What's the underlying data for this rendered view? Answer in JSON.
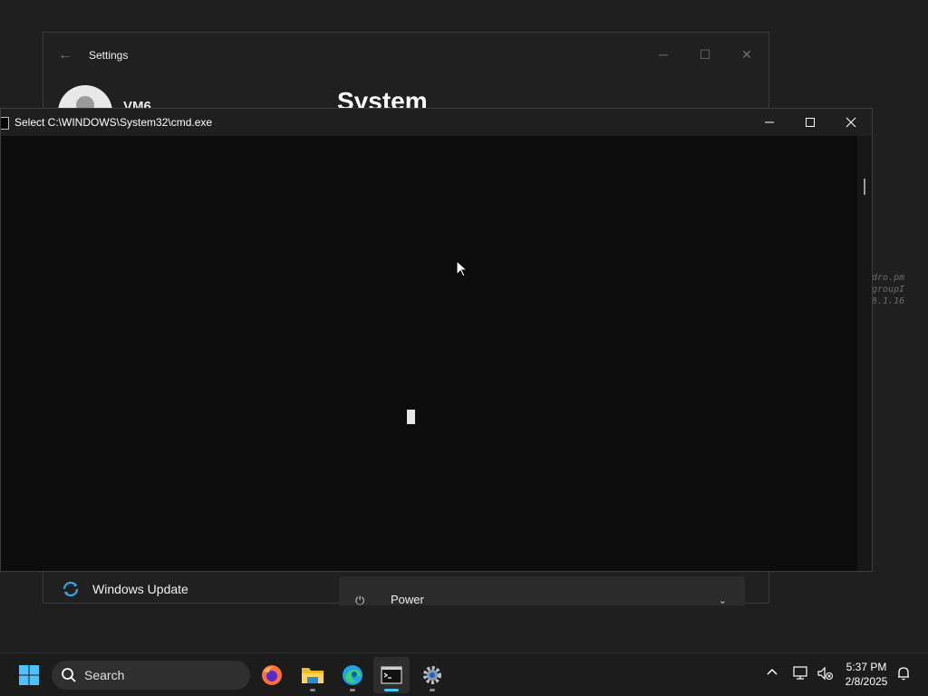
{
  "desktop": {
    "background_text": [
      "dro.pm",
      "groupI",
      "8.1.16"
    ]
  },
  "settings_window": {
    "title": "Settings",
    "user_name": "VM6",
    "page_title": "System",
    "nav_windows_update": "Windows Update",
    "card_power": "Power"
  },
  "cmd_window": {
    "title": "Select C:\\WINDOWS\\System32\\cmd.exe",
    "minimize_icon": "minimize-icon",
    "maximize_icon": "maximize-icon",
    "close_icon": "close-icon"
  },
  "taskbar": {
    "search_placeholder": "Search",
    "apps": [
      "start",
      "firefox",
      "file-explorer",
      "edge",
      "terminal",
      "settings"
    ],
    "active_app": "terminal",
    "time": "5:37 PM",
    "date": "2/8/2025"
  },
  "colors": {
    "accent": "#4cc2ff",
    "console_bg": "#0c0c0c",
    "taskbar_bg": "#1c1c1c"
  }
}
